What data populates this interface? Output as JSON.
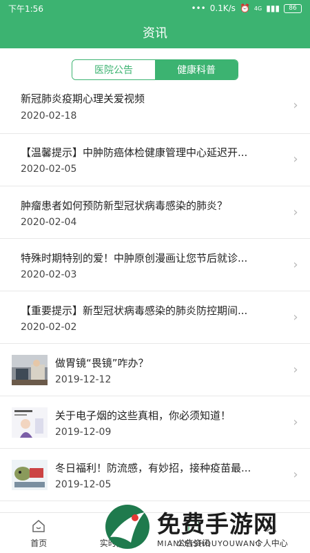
{
  "status_bar": {
    "time": "下午1:56",
    "network_speed": "0.1K/s",
    "signal": "4G",
    "battery": "86"
  },
  "header": {
    "title": "资讯"
  },
  "tabs": [
    {
      "label": "医院公告",
      "active": false
    },
    {
      "label": "健康科普",
      "active": true
    }
  ],
  "articles": [
    {
      "title": "新冠肺炎疫期心理关爱视频",
      "date": "2020-02-18",
      "thumb": false
    },
    {
      "title": "【温馨提示】中肿防癌体检健康管理中心延迟开...",
      "date": "2020-02-05",
      "thumb": false
    },
    {
      "title": "肿瘤患者如何预防新型冠状病毒感染的肺炎？",
      "date": "2020-02-04",
      "thumb": false
    },
    {
      "title": "特殊时期特别的爱！中肿原创漫画让您节后就诊...",
      "date": "2020-02-03",
      "thumb": false
    },
    {
      "title": "【重要提示】新型冠状病毒感染的肺炎防控期间...",
      "date": "2020-02-02",
      "thumb": false
    },
    {
      "title": "做胃镜“畏镜”咋办？",
      "date": "2019-12-12",
      "thumb": true,
      "thumb_icon": "photo-thumbnail-icon"
    },
    {
      "title": "关于电子烟的这些真相，你必须知道！",
      "date": "2019-12-09",
      "thumb": true,
      "thumb_icon": "cartoon-thumbnail-icon"
    },
    {
      "title": "冬日福利！防流感，有妙招，接种疫苗最...",
      "date": "2019-12-05",
      "thumb": true,
      "thumb_icon": "cartoon-thumbnail-icon"
    }
  ],
  "bottom_nav": [
    {
      "label": "首页",
      "icon": "home-icon"
    },
    {
      "label": "实时指南",
      "icon": "guide-icon"
    },
    {
      "label": "公告资讯",
      "icon": "news-icon"
    },
    {
      "label": "个人中心",
      "icon": "user-icon"
    }
  ],
  "watermark": {
    "big": "免费手游网",
    "small": "MIANFEISHOUYOUWANG"
  },
  "colors": {
    "brand": "#3cb371",
    "chevron": "#b8b8b8"
  }
}
